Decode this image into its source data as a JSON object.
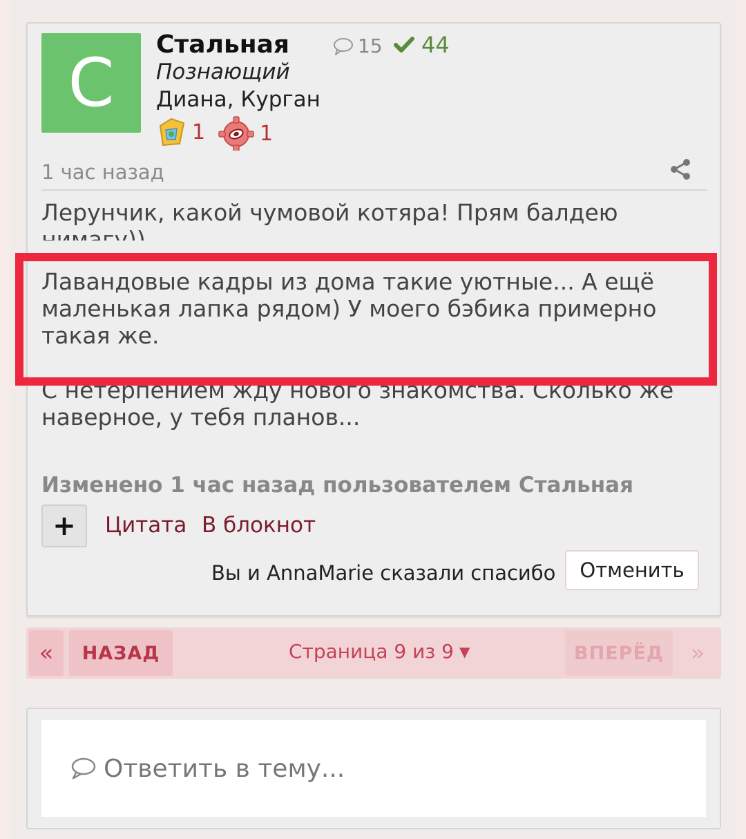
{
  "post": {
    "avatar_letter": "С",
    "author_name": "Стальная",
    "author_rank": "Познающий",
    "author_location": "Диана, Курган",
    "comments_count": "15",
    "likes_count": "44",
    "awards": [
      {
        "icon": "folder-award-icon",
        "count": "1"
      },
      {
        "icon": "gear-award-icon",
        "count": "1"
      }
    ],
    "timestamp": "1 час назад",
    "paragraphs": [
      "Лерунчик, какой чумовой котяра! Прям балдею нимагу))",
      "Лавандовые кадры из дома такие уютные... А ещё маленькая лапка рядом) У моего бэбика примерно такая же.",
      "С нетерпением жду нового знакомства. Сколько же наверное, у тебя планов..."
    ],
    "edited_note": "Изменено 1 час назад пользователем Стальная",
    "plus_label": "+",
    "quote_label": "Цитата",
    "notebook_label": "В блокнот",
    "thanks_text": "Вы и AnnaMarie сказали спасибо",
    "cancel_label": "Отменить"
  },
  "pager": {
    "first_label": "«",
    "back_label": "НАЗАД",
    "status": "Страница 9 из 9",
    "next_label": "ВПЕРЁД",
    "last_label": "»"
  },
  "reply": {
    "placeholder": "Ответить в тему..."
  },
  "colors": {
    "avatar_bg": "#6bc46d",
    "highlight": "#ee2740",
    "link": "#7a1c2e",
    "pager_accent": "#c44257"
  }
}
